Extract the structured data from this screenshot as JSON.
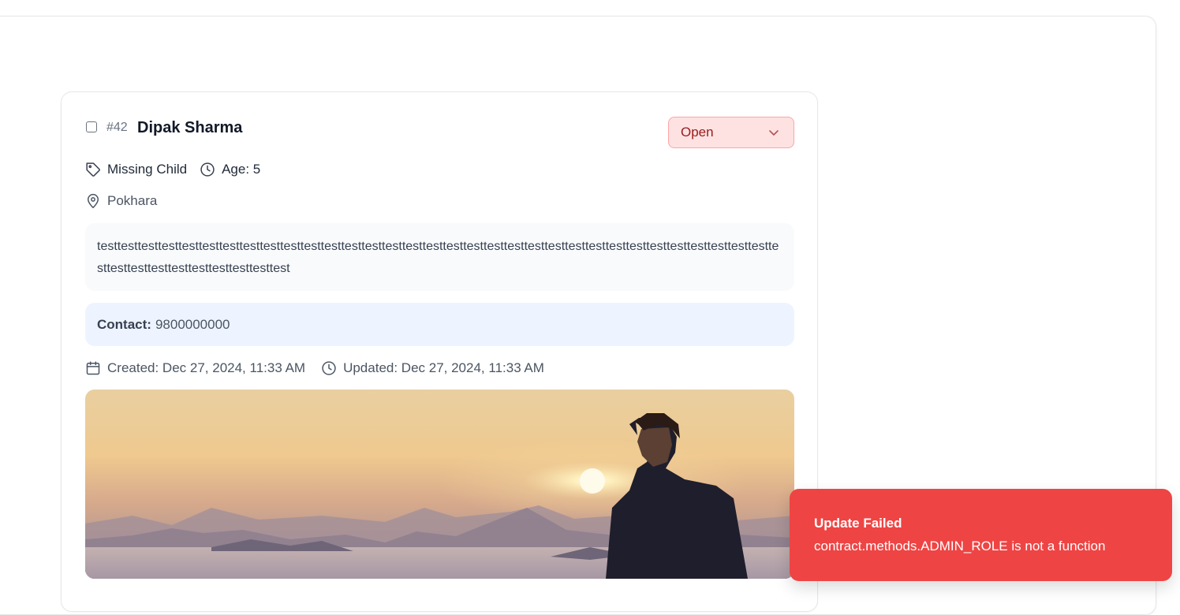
{
  "case": {
    "id_label": "#42",
    "name": "Dipak Sharma",
    "status": "Open",
    "category": "Missing Child",
    "age_label": "Age: 5",
    "location": "Pokhara",
    "description": "testtesttesttesttesttesttesttesttesttesttesttesttesttesttesttesttesttesttesttesttesttesttesttesttesttesttesttesttesttesttesttesttesttesttesttesttesttesttesttesttesttesttest",
    "contact_label": "Contact:",
    "contact_value": "9800000000",
    "created_label": "Created: Dec 27, 2024, 11:33 AM",
    "updated_label": "Updated: Dec 27, 2024, 11:33 AM"
  },
  "toast": {
    "title": "Update Failed",
    "message": "contract.methods.ADMIN_ROLE is not a function"
  },
  "icons": {
    "tag": "tag-icon",
    "clock": "clock-icon",
    "location": "map-pin-icon",
    "calendar": "calendar-icon",
    "chevron": "chevron-down-icon"
  },
  "colors": {
    "status_bg": "#fee2e2",
    "status_text": "#991b1b",
    "toast_bg": "#ef4444",
    "contact_bg": "#eef4ff"
  }
}
